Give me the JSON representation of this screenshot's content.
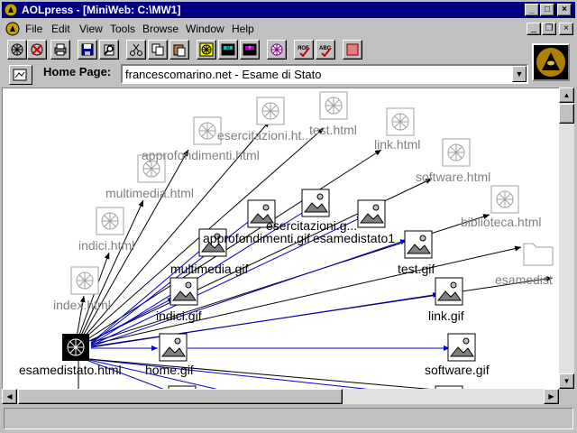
{
  "window": {
    "title": "AOLpress - [MiniWeb: C:\\MW1]",
    "controls": {
      "minimize": "_",
      "maximize": "□",
      "close": "×"
    }
  },
  "menu": {
    "items": [
      "File",
      "Edit",
      "View",
      "Tools",
      "Browse",
      "Window",
      "Help"
    ],
    "doc_controls": {
      "minimize": "_",
      "restore": "❐",
      "close": "×"
    }
  },
  "toolbar": {
    "buttons": [
      "open-web-icon",
      "close-web-icon",
      "print-icon",
      "save-icon",
      "find-icon",
      "cut-icon",
      "copy-icon",
      "paste-icon",
      "map-view-icon",
      "browse-mode-icon",
      "edit-mode-icon",
      "link-check-icon",
      "page-check-icon",
      "spell-check-icon",
      "stop-icon"
    ]
  },
  "home": {
    "label": "Home Page:",
    "value": "francescomarino.net - Esame di Stato"
  },
  "map": {
    "root": "esamedistato.html",
    "html_nodes": [
      "index.html",
      "indici.html",
      "multimedia.html",
      "approfondimenti.html",
      "esercitazioni.ht...",
      "test.html",
      "link.html",
      "software.html",
      "biblioteca.html",
      "esamedist"
    ],
    "gif_nodes": [
      "indici.gif",
      "multimedia.gif",
      "approfondimenti.gif",
      "esercitazioni.g...",
      "esamedistato1",
      "test.gif",
      "link.gif",
      "home.gif",
      "software.gif"
    ]
  },
  "colors": {
    "titlebar": "#000080",
    "link_blue": "#0000cc",
    "link_black": "#000000",
    "ghost_label": "#808080"
  }
}
